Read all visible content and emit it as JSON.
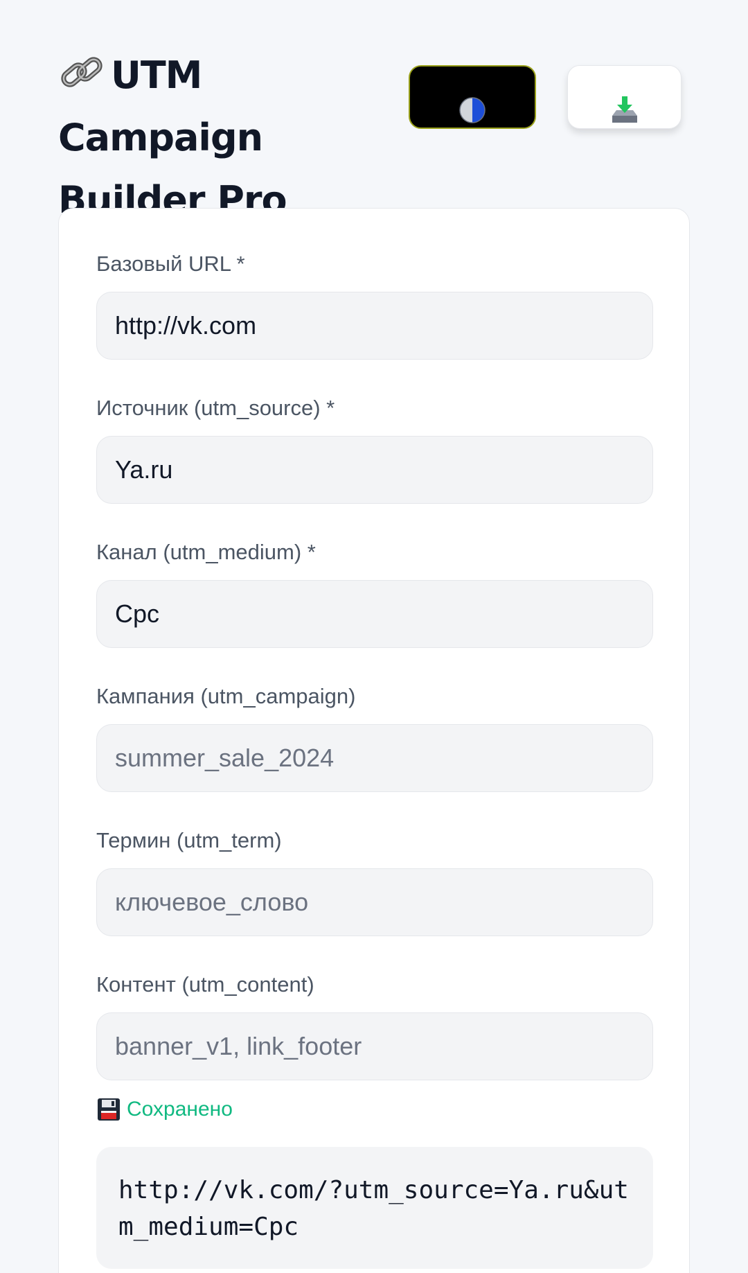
{
  "header": {
    "title": "UTM Campaign Builder Pro",
    "title_icon": "link-icon",
    "theme_button_icon": "half-circle-icon",
    "export_button_icon": "download-tray-icon"
  },
  "form": {
    "fields": [
      {
        "label": "Базовый URL *",
        "value": "http://vk.com",
        "placeholder": ""
      },
      {
        "label": "Источник (utm_source) *",
        "value": "Ya.ru",
        "placeholder": ""
      },
      {
        "label": "Канал (utm_medium) *",
        "value": "Cpc",
        "placeholder": ""
      },
      {
        "label": "Кампания (utm_campaign)",
        "value": "",
        "placeholder": "summer_sale_2024"
      },
      {
        "label": "Термин (utm_term)",
        "value": "",
        "placeholder": "ключевое_слово"
      },
      {
        "label": "Контент (utm_content)",
        "value": "",
        "placeholder": "banner_v1, link_footer"
      }
    ]
  },
  "status": {
    "icon": "floppy-disk-icon",
    "text": "Сохранено"
  },
  "result": {
    "url": "http://vk.com/?utm_source=Ya.ru&utm_medium=Cpc"
  },
  "colors": {
    "background": "#f5f7fa",
    "accent_saved": "#10b981",
    "theme_button_bg": "#000000",
    "theme_button_border": "#9aa11a"
  }
}
